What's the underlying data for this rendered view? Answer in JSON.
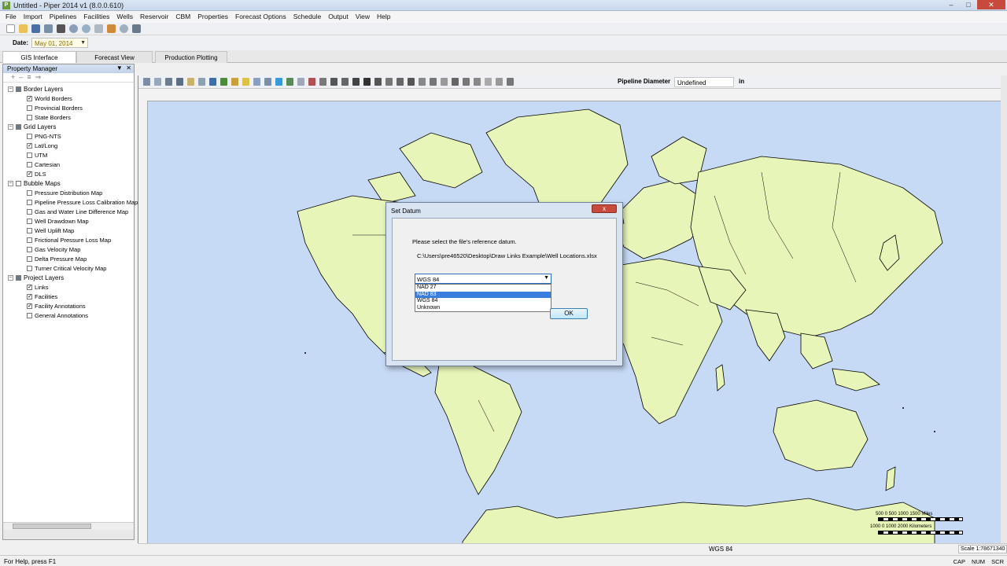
{
  "window": {
    "title": "Untitled - Piper 2014 v1  (8.0.0.610)",
    "app_icon": "P"
  },
  "menu": [
    "File",
    "Import",
    "Pipelines",
    "Facilities",
    "Wells",
    "Reservoir",
    "CBM",
    "Properties",
    "Forecast Options",
    "Schedule",
    "Output",
    "View",
    "Help"
  ],
  "date": {
    "label": "Date:",
    "value": "May 01, 2014"
  },
  "tabs": [
    "GIS Interface",
    "Forecast View",
    "Production Plotting"
  ],
  "property_manager": {
    "title": "Property Manager",
    "tree": [
      {
        "label": "Border Layers",
        "type": "category",
        "checked": "partial"
      },
      {
        "label": "World Borders",
        "type": "item",
        "checked": true
      },
      {
        "label": "Provincial Borders",
        "type": "item",
        "checked": false
      },
      {
        "label": "State Borders",
        "type": "item",
        "checked": false
      },
      {
        "label": "Grid Layers",
        "type": "category",
        "checked": "partial"
      },
      {
        "label": "PNG-NTS",
        "type": "item",
        "checked": false
      },
      {
        "label": "Lat/Long",
        "type": "item",
        "checked": true
      },
      {
        "label": "UTM",
        "type": "item",
        "checked": false
      },
      {
        "label": "Cartesian",
        "type": "item",
        "checked": false
      },
      {
        "label": "DLS",
        "type": "item",
        "checked": true
      },
      {
        "label": "Bubble Maps",
        "type": "category",
        "checked": false
      },
      {
        "label": "Pressure Distribution Map",
        "type": "item",
        "checked": false
      },
      {
        "label": "Pipeline Pressure Loss Calibration Map",
        "type": "item",
        "checked": false
      },
      {
        "label": "Gas and Water Line Difference Map",
        "type": "item",
        "checked": false
      },
      {
        "label": "Well Drawdown Map",
        "type": "item",
        "checked": false
      },
      {
        "label": "Well Uplift Map",
        "type": "item",
        "checked": false
      },
      {
        "label": "Frictional Pressure Loss Map",
        "type": "item",
        "checked": false
      },
      {
        "label": "Gas Velocity Map",
        "type": "item",
        "checked": false
      },
      {
        "label": "Delta Pressure Map",
        "type": "item",
        "checked": false
      },
      {
        "label": "Turner Critical Velocity Map",
        "type": "item",
        "checked": false
      },
      {
        "label": "Project Layers",
        "type": "category",
        "checked": "partial"
      },
      {
        "label": "Links",
        "type": "item",
        "checked": true
      },
      {
        "label": "Facilities",
        "type": "item",
        "checked": true
      },
      {
        "label": "Facility Annotations",
        "type": "item",
        "checked": true
      },
      {
        "label": "General Annotations",
        "type": "item",
        "checked": false
      }
    ]
  },
  "map_toolbar": {
    "pipeline_label": "Pipeline Diameter",
    "pipeline_value": "Undefined",
    "unit": "in"
  },
  "dialog": {
    "title": "Set Datum",
    "close": "x",
    "prompt": "Please select the file's reference datum.",
    "path": "C:\\Users\\pre46520\\Desktop\\Draw Links Example\\Well Locations.xlsx",
    "selected": "WGS 84",
    "options": [
      "NAD 27",
      "NAD 83",
      "WGS 84",
      "Unknown"
    ],
    "highlighted_index": 1,
    "ok": "OK"
  },
  "scalebar": {
    "miles": "500          0          500        1000        1500 Miles",
    "km": "1000          0          1000        2000 Kilometers"
  },
  "map_status": {
    "datum": "WGS 84",
    "scale": "Scale 1:78671340"
  },
  "status": {
    "help": "For Help, press F1",
    "keys": [
      "CAP",
      "NUM",
      "SCR"
    ]
  },
  "colors": {
    "ocean": "#c6d9f5",
    "land": "#e8f5b8",
    "accent": "#3a7fe0"
  }
}
